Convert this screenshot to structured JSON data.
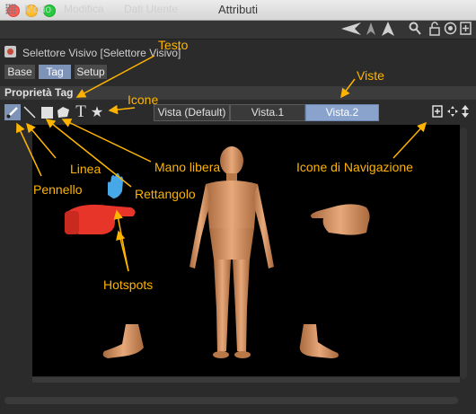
{
  "window": {
    "title": "Attributi"
  },
  "menubar": {
    "items": [
      "Modo",
      "Modifica",
      "Dati Utente"
    ]
  },
  "object": {
    "title": "Selettore Visivo [Selettore Visivo]"
  },
  "tabs": [
    {
      "label": "Base",
      "active": false
    },
    {
      "label": "Tag",
      "active": true
    },
    {
      "label": "Setup",
      "active": false
    }
  ],
  "section": {
    "label": "Proprietà Tag"
  },
  "tools": [
    {
      "name": "brush-icon",
      "glyph": "✎",
      "active": true
    },
    {
      "name": "line-icon",
      "glyph": "╲",
      "active": false
    },
    {
      "name": "rectangle-icon",
      "glyph": "■",
      "active": false
    },
    {
      "name": "freehand-icon",
      "glyph": "⬟",
      "active": false
    },
    {
      "name": "text-icon",
      "glyph": "T",
      "active": false
    },
    {
      "name": "star-icon",
      "glyph": "★",
      "active": false
    }
  ],
  "views": [
    {
      "label": "Vista (Default)",
      "active": false
    },
    {
      "label": "Vista.1",
      "active": false
    },
    {
      "label": "Vista.2",
      "active": true
    }
  ],
  "annotations": {
    "testo": "Testo",
    "viste": "Viste",
    "icone": "Icone",
    "linea": "Linea",
    "pennello": "Pennello",
    "mano_libera": "Mano libera",
    "rettangolo": "Rettangolo",
    "icone_navigazione": "Icone di Navigazione",
    "hotspots": "Hotspots"
  },
  "colors": {
    "accent": "#7d93b7",
    "annotation": "#ffb400",
    "hotspot": "#e8352a"
  }
}
